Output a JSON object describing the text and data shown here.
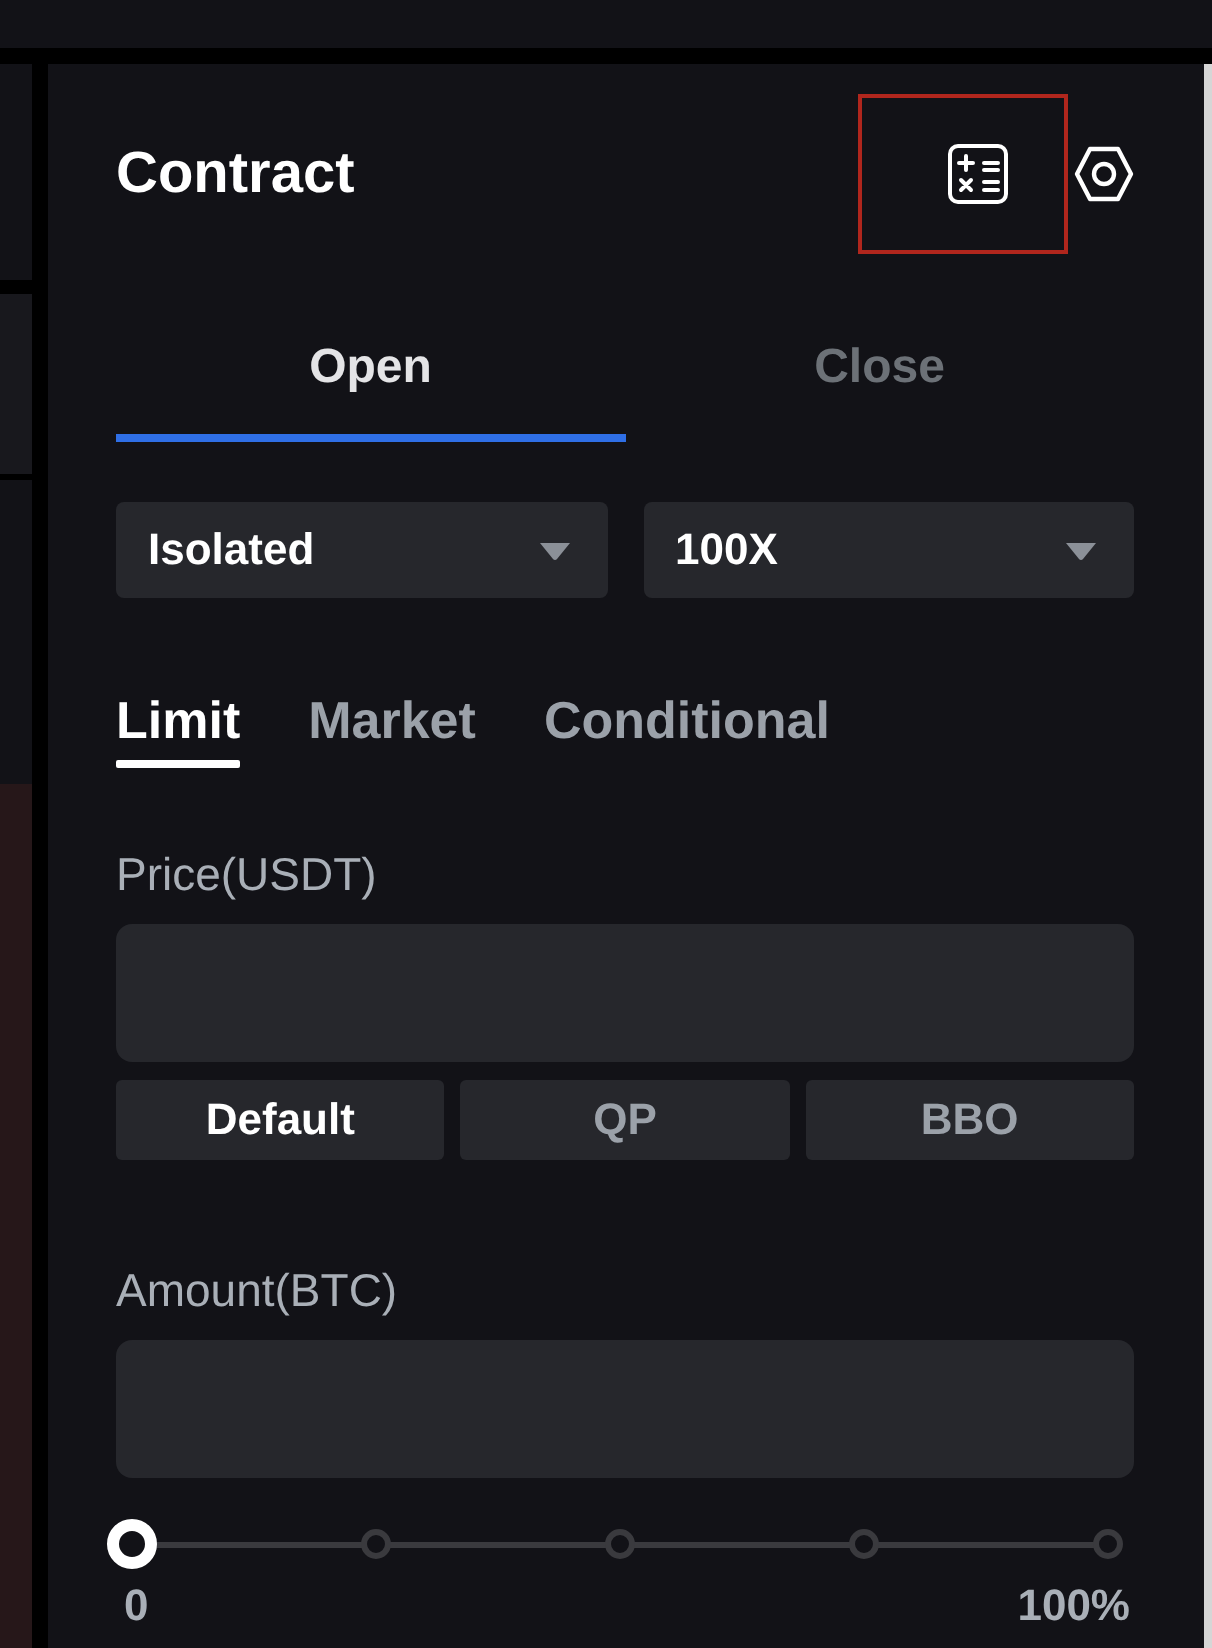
{
  "header": {
    "title": "Contract",
    "calculator_highlighted": true
  },
  "position_tabs": [
    {
      "label": "Open",
      "selected": true
    },
    {
      "label": "Close",
      "selected": false
    }
  ],
  "selectors": [
    {
      "value": "Isolated"
    },
    {
      "value": "100X"
    }
  ],
  "order_types": [
    {
      "label": "Limit",
      "selected": true
    },
    {
      "label": "Market",
      "selected": false
    },
    {
      "label": "Conditional",
      "selected": false
    }
  ],
  "price": {
    "label": "Price(USDT)"
  },
  "price_modes": [
    {
      "label": "Default",
      "selected": true
    },
    {
      "label": "QP",
      "selected": false
    },
    {
      "label": "BBO",
      "selected": false
    }
  ],
  "amount": {
    "label": "Amount(BTC)"
  },
  "amount_slider": {
    "level": 0,
    "min_label": "0",
    "max_label": "100%"
  }
}
